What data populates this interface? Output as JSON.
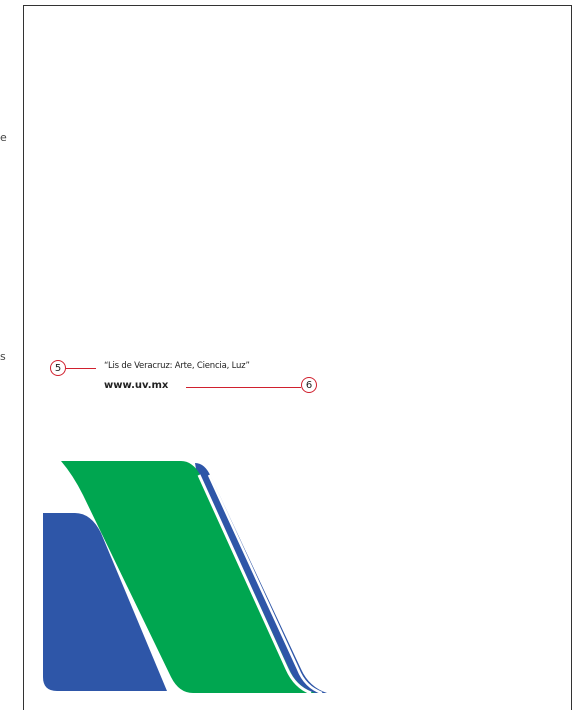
{
  "edge_glyphs": [
    "e",
    "s"
  ],
  "motto": "“Lis de Veracruz: Arte, Ciencia, Luz”",
  "website": "www.uv.mx",
  "markers": {
    "motto": "5",
    "website": "6"
  },
  "colors": {
    "annotation_red": "#d0202e",
    "logo_blue": "#2e56a8",
    "logo_green": "#00a650",
    "page_border": "#333333"
  },
  "logo_name": "uv-stripes-logo"
}
